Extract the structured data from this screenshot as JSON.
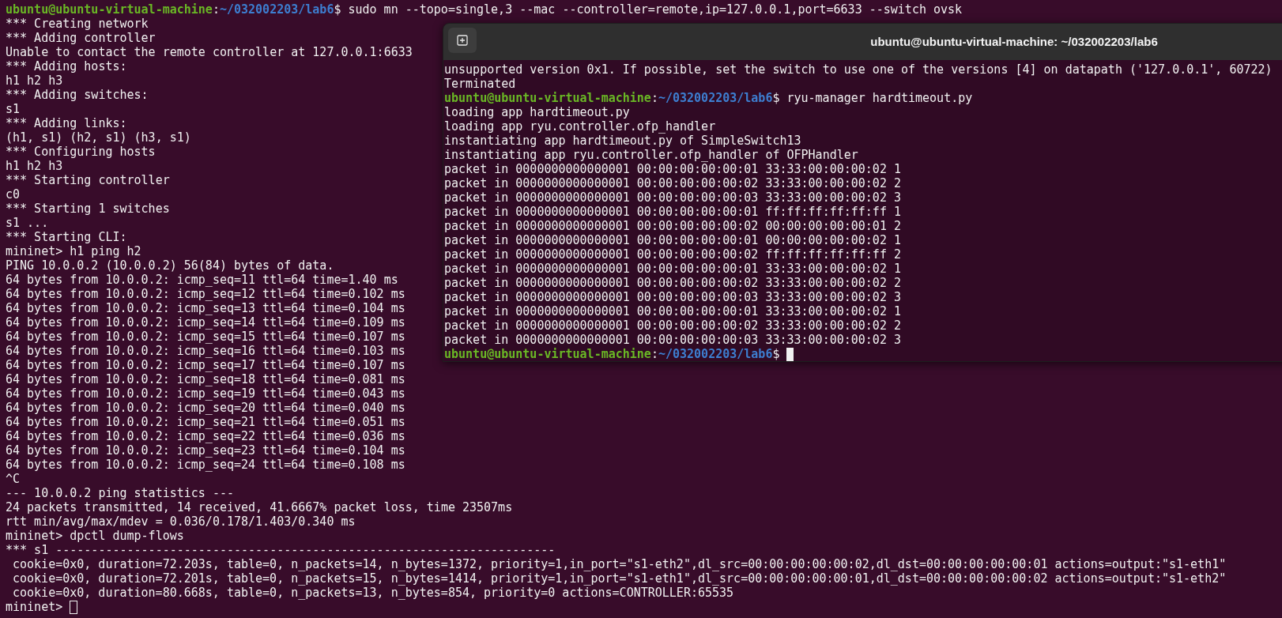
{
  "background_terminal": {
    "focused": false,
    "lines": [
      {
        "kind": "prompt",
        "user_host": "ubuntu@ubuntu-virtual-machine",
        "colon": ":",
        "path": "~/032002203/lab6",
        "symbol": "$",
        "command": "sudo mn --topo=single,3 --mac --controller=remote,ip=127.0.0.1,port=6633 --switch ovsk"
      },
      {
        "kind": "output",
        "text": "*** Creating network"
      },
      {
        "kind": "output",
        "text": "*** Adding controller"
      },
      {
        "kind": "output",
        "text": "Unable to contact the remote controller at 127.0.0.1:6633"
      },
      {
        "kind": "output",
        "text": "*** Adding hosts:"
      },
      {
        "kind": "output",
        "text": "h1 h2 h3"
      },
      {
        "kind": "output",
        "text": "*** Adding switches:"
      },
      {
        "kind": "output",
        "text": "s1"
      },
      {
        "kind": "output",
        "text": "*** Adding links:"
      },
      {
        "kind": "output",
        "text": "(h1, s1) (h2, s1) (h3, s1)"
      },
      {
        "kind": "output",
        "text": "*** Configuring hosts"
      },
      {
        "kind": "output",
        "text": "h1 h2 h3"
      },
      {
        "kind": "output",
        "text": "*** Starting controller"
      },
      {
        "kind": "output",
        "text": "c0"
      },
      {
        "kind": "output",
        "text": "*** Starting 1 switches"
      },
      {
        "kind": "output",
        "text": "s1 ..."
      },
      {
        "kind": "output",
        "text": "*** Starting CLI:"
      },
      {
        "kind": "output",
        "text": "mininet> h1 ping h2"
      },
      {
        "kind": "output",
        "text": "PING 10.0.0.2 (10.0.0.2) 56(84) bytes of data."
      },
      {
        "kind": "output",
        "text": "64 bytes from 10.0.0.2: icmp_seq=11 ttl=64 time=1.40 ms"
      },
      {
        "kind": "output",
        "text": "64 bytes from 10.0.0.2: icmp_seq=12 ttl=64 time=0.102 ms"
      },
      {
        "kind": "output",
        "text": "64 bytes from 10.0.0.2: icmp_seq=13 ttl=64 time=0.104 ms"
      },
      {
        "kind": "output",
        "text": "64 bytes from 10.0.0.2: icmp_seq=14 ttl=64 time=0.109 ms"
      },
      {
        "kind": "output",
        "text": "64 bytes from 10.0.0.2: icmp_seq=15 ttl=64 time=0.107 ms"
      },
      {
        "kind": "output",
        "text": "64 bytes from 10.0.0.2: icmp_seq=16 ttl=64 time=0.103 ms"
      },
      {
        "kind": "output",
        "text": "64 bytes from 10.0.0.2: icmp_seq=17 ttl=64 time=0.107 ms"
      },
      {
        "kind": "output",
        "text": "64 bytes from 10.0.0.2: icmp_seq=18 ttl=64 time=0.081 ms"
      },
      {
        "kind": "output",
        "text": "64 bytes from 10.0.0.2: icmp_seq=19 ttl=64 time=0.043 ms"
      },
      {
        "kind": "output",
        "text": "64 bytes from 10.0.0.2: icmp_seq=20 ttl=64 time=0.040 ms"
      },
      {
        "kind": "output",
        "text": "64 bytes from 10.0.0.2: icmp_seq=21 ttl=64 time=0.051 ms"
      },
      {
        "kind": "output",
        "text": "64 bytes from 10.0.0.2: icmp_seq=22 ttl=64 time=0.036 ms"
      },
      {
        "kind": "output",
        "text": "64 bytes from 10.0.0.2: icmp_seq=23 ttl=64 time=0.104 ms"
      },
      {
        "kind": "output",
        "text": "64 bytes from 10.0.0.2: icmp_seq=24 ttl=64 time=0.108 ms"
      },
      {
        "kind": "output",
        "text": "^C"
      },
      {
        "kind": "output",
        "text": "--- 10.0.0.2 ping statistics ---"
      },
      {
        "kind": "output",
        "text": "24 packets transmitted, 14 received, 41.6667% packet loss, time 23507ms"
      },
      {
        "kind": "output",
        "text": "rtt min/avg/max/mdev = 0.036/0.178/1.403/0.340 ms"
      },
      {
        "kind": "output",
        "text": "mininet> dpctl dump-flows"
      },
      {
        "kind": "output",
        "text": "*** s1 ----------------------------------------------------------------------"
      },
      {
        "kind": "indented",
        "text": "cookie=0x0, duration=72.203s, table=0, n_packets=14, n_bytes=1372, priority=1,in_port=\"s1-eth2\",dl_src=00:00:00:00:00:02,dl_dst=00:00:00:00:00:01 actions=output:\"s1-eth1\""
      },
      {
        "kind": "indented",
        "text": "cookie=0x0, duration=72.201s, table=0, n_packets=15, n_bytes=1414, priority=1,in_port=\"s1-eth1\",dl_src=00:00:00:00:00:01,dl_dst=00:00:00:00:00:02 actions=output:\"s1-eth2\""
      },
      {
        "kind": "indented",
        "text": "cookie=0x0, duration=80.668s, table=0, n_packets=13, n_bytes=854, priority=0 actions=CONTROLLER:65535"
      },
      {
        "kind": "input",
        "text": "mininet>"
      }
    ]
  },
  "front_window": {
    "title": "ubuntu@ubuntu-virtual-machine: ~/032002203/lab6",
    "focused": true,
    "lines": [
      {
        "kind": "output",
        "text": "unsupported version 0x1. If possible, set the switch to use one of the versions [4] on datapath ('127.0.0.1', 60722)"
      },
      {
        "kind": "output",
        "text": "Terminated"
      },
      {
        "kind": "prompt",
        "user_host": "ubuntu@ubuntu-virtual-machine",
        "colon": ":",
        "path": "~/032002203/lab6",
        "symbol": "$",
        "command": "ryu-manager hardtimeout.py"
      },
      {
        "kind": "output",
        "text": "loading app hardtimeout.py"
      },
      {
        "kind": "output",
        "text": "loading app ryu.controller.ofp_handler"
      },
      {
        "kind": "output",
        "text": "instantiating app hardtimeout.py of SimpleSwitch13"
      },
      {
        "kind": "output",
        "text": "instantiating app ryu.controller.ofp_handler of OFPHandler"
      },
      {
        "kind": "output",
        "text": "packet in 0000000000000001 00:00:00:00:00:01 33:33:00:00:00:02 1"
      },
      {
        "kind": "output",
        "text": "packet in 0000000000000001 00:00:00:00:00:02 33:33:00:00:00:02 2"
      },
      {
        "kind": "output",
        "text": "packet in 0000000000000001 00:00:00:00:00:03 33:33:00:00:00:02 3"
      },
      {
        "kind": "output",
        "text": "packet in 0000000000000001 00:00:00:00:00:01 ff:ff:ff:ff:ff:ff 1"
      },
      {
        "kind": "output",
        "text": "packet in 0000000000000001 00:00:00:00:00:02 00:00:00:00:00:01 2"
      },
      {
        "kind": "output",
        "text": "packet in 0000000000000001 00:00:00:00:00:01 00:00:00:00:00:02 1"
      },
      {
        "kind": "output",
        "text": "packet in 0000000000000001 00:00:00:00:00:02 ff:ff:ff:ff:ff:ff 2"
      },
      {
        "kind": "output",
        "text": "packet in 0000000000000001 00:00:00:00:00:01 33:33:00:00:00:02 1"
      },
      {
        "kind": "output",
        "text": "packet in 0000000000000001 00:00:00:00:00:02 33:33:00:00:00:02 2"
      },
      {
        "kind": "output",
        "text": "packet in 0000000000000001 00:00:00:00:00:03 33:33:00:00:00:02 3"
      },
      {
        "kind": "output",
        "text": "packet in 0000000000000001 00:00:00:00:00:01 33:33:00:00:00:02 1"
      },
      {
        "kind": "output",
        "text": "packet in 0000000000000001 00:00:00:00:00:02 33:33:00:00:00:02 2"
      },
      {
        "kind": "output",
        "text": "packet in 0000000000000001 00:00:00:00:00:03 33:33:00:00:00:02 3"
      },
      {
        "kind": "prompt",
        "user_host": "ubuntu@ubuntu-virtual-machine",
        "colon": ":",
        "path": "~/032002203/lab6",
        "symbol": "$"
      }
    ]
  }
}
